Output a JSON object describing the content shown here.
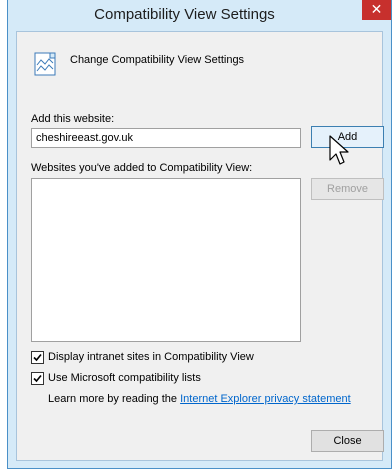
{
  "window": {
    "title": "Compatibility View Settings",
    "close_glyph": "✕"
  },
  "header": {
    "icon": "compatibility-view-icon",
    "text": "Change Compatibility View Settings"
  },
  "add_website": {
    "label": "Add this website:",
    "value": "cheshireeast.gov.uk",
    "add_button": "Add"
  },
  "list": {
    "label": "Websites you've added to Compatibility View:",
    "items": [],
    "remove_button": "Remove"
  },
  "options": {
    "intranet_label": "Display intranet sites in Compatibility View",
    "intranet_checked": true,
    "microsoft_label": "Use Microsoft compatibility lists",
    "microsoft_checked": true
  },
  "learn_more": {
    "prefix": "Learn more by reading the ",
    "link_text": "Internet Explorer privacy statement"
  },
  "footer": {
    "close_button": "Close"
  },
  "colors": {
    "accent": "#4a90c8",
    "close_red": "#c7302d",
    "link": "#0066cc"
  }
}
